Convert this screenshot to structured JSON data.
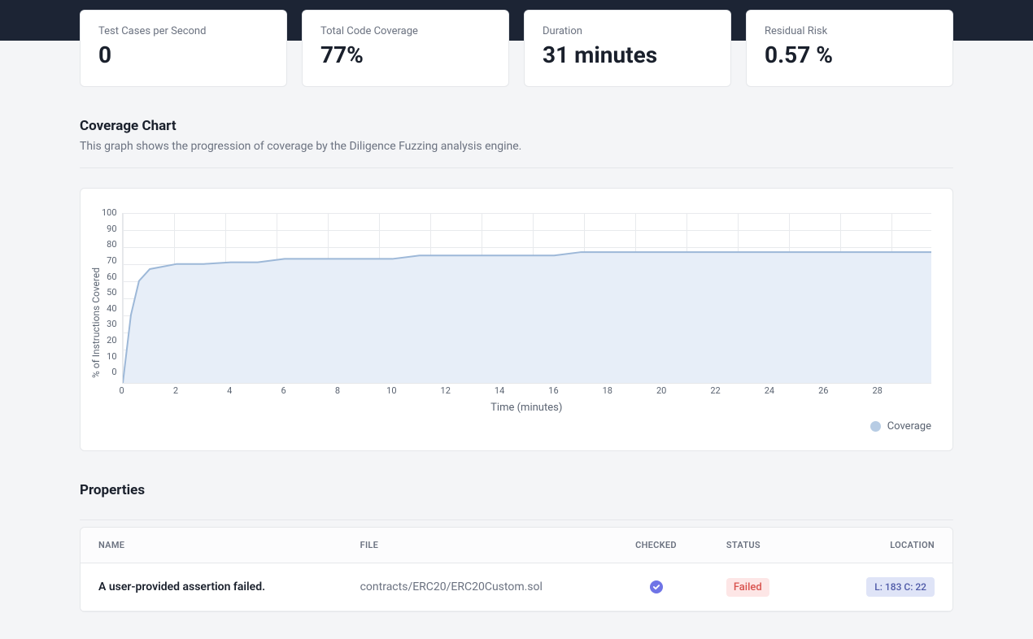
{
  "metrics": [
    {
      "label": "Test Cases per Second",
      "value": "0"
    },
    {
      "label": "Total Code Coverage",
      "value": "77%"
    },
    {
      "label": "Duration",
      "value": "31 minutes"
    },
    {
      "label": "Residual Risk",
      "value": "0.57 %"
    }
  ],
  "coverage_section": {
    "title": "Coverage Chart",
    "subtitle": "This graph shows the progression of coverage by the Diligence Fuzzing analysis engine."
  },
  "chart_data": {
    "type": "area",
    "title": "",
    "xlabel": "Time (minutes)",
    "ylabel": "% of Instructions Covered",
    "xlim": [
      0,
      30
    ],
    "ylim": [
      0,
      100
    ],
    "x_ticks": [
      0,
      2,
      4,
      6,
      8,
      10,
      12,
      14,
      16,
      18,
      20,
      22,
      24,
      26,
      28
    ],
    "y_ticks": [
      0,
      10,
      20,
      30,
      40,
      50,
      60,
      70,
      80,
      90,
      100
    ],
    "series": [
      {
        "name": "Coverage",
        "x": [
          0,
          0.3,
          0.6,
          1,
          2,
          3,
          4,
          5,
          6,
          7,
          8,
          10,
          11,
          12,
          14,
          16,
          17,
          20,
          24,
          28,
          30
        ],
        "values": [
          0,
          40,
          60,
          67,
          70,
          70,
          71,
          71,
          73,
          73,
          73,
          73,
          75,
          75,
          75,
          75,
          77,
          77,
          77,
          77,
          77
        ]
      }
    ],
    "legend_position": "bottom-right",
    "colors": {
      "line": "#9db8d8",
      "fill": "#e7eef8"
    }
  },
  "properties_section": {
    "title": "Properties"
  },
  "properties_table": {
    "columns": [
      "NAME",
      "FILE",
      "CHECKED",
      "STATUS",
      "LOCATION"
    ],
    "rows": [
      {
        "name": "A user-provided assertion failed.",
        "file": "contracts/ERC20/ERC20Custom.sol",
        "checked": true,
        "status": "Failed",
        "location": "L: 183 C: 22"
      }
    ]
  }
}
